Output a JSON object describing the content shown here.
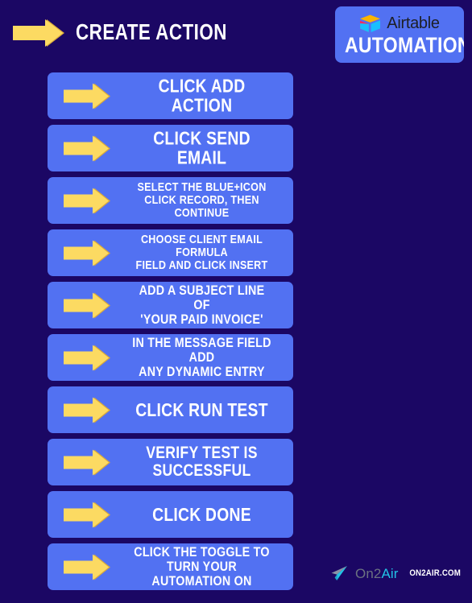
{
  "header": {
    "title": "CREATE ACTION",
    "arrow_icon": "arrow-right-icon"
  },
  "badge": {
    "brand": "Airtable",
    "subtitle": "AUTOMATIONS",
    "logo_icon": "airtable-cube-icon",
    "background_color": "#5271F2"
  },
  "theme": {
    "page_background": "#1B0764",
    "button_blue": "#5271F2",
    "arrow_yellow": "#FCDA62",
    "arrow_shadow": "#D9A93C",
    "text_white": "#FFFFFF",
    "accent_cyan": "#22C3E6",
    "muted_gray": "#6B7280"
  },
  "steps": [
    {
      "lines": [
        "CLICK ADD ACTION"
      ],
      "size": "xl",
      "arrow_icon": "arrow-right-icon"
    },
    {
      "lines": [
        "CLICK SEND EMAIL"
      ],
      "size": "xl",
      "arrow_icon": "arrow-right-icon"
    },
    {
      "lines": [
        "SELECT THE BLUE+ICON",
        "CLICK RECORD, THEN CONTINUE"
      ],
      "size": "sm",
      "arrow_icon": "arrow-right-icon"
    },
    {
      "lines": [
        "CHOOSE CLIENT EMAIL FORMULA",
        "FIELD AND CLICK INSERT"
      ],
      "size": "sm",
      "arrow_icon": "arrow-right-icon"
    },
    {
      "lines": [
        "ADD A SUBJECT LINE OF",
        "'YOUR PAID INVOICE'"
      ],
      "size": "md",
      "arrow_icon": "arrow-right-icon"
    },
    {
      "lines": [
        "IN THE MESSAGE FIELD ADD",
        "ANY DYNAMIC ENTRY"
      ],
      "size": "md",
      "arrow_icon": "arrow-right-icon"
    },
    {
      "lines": [
        "CLICK RUN TEST"
      ],
      "size": "xl",
      "arrow_icon": "arrow-right-icon"
    },
    {
      "lines": [
        "VERIFY TEST IS SUCCESSFUL"
      ],
      "size": "lg",
      "arrow_icon": "arrow-right-icon"
    },
    {
      "lines": [
        "CLICK DONE"
      ],
      "size": "xl",
      "arrow_icon": "arrow-right-icon"
    },
    {
      "lines": [
        "CLICK THE TOGGLE TO TURN YOUR",
        "AUTOMATION ON"
      ],
      "size": "md",
      "arrow_icon": "arrow-right-icon"
    }
  ],
  "footer": {
    "brand_prefix": "On2",
    "brand_suffix": "Air",
    "url": "ON2AIR.COM",
    "logo_icon": "paper-plane-icon"
  }
}
